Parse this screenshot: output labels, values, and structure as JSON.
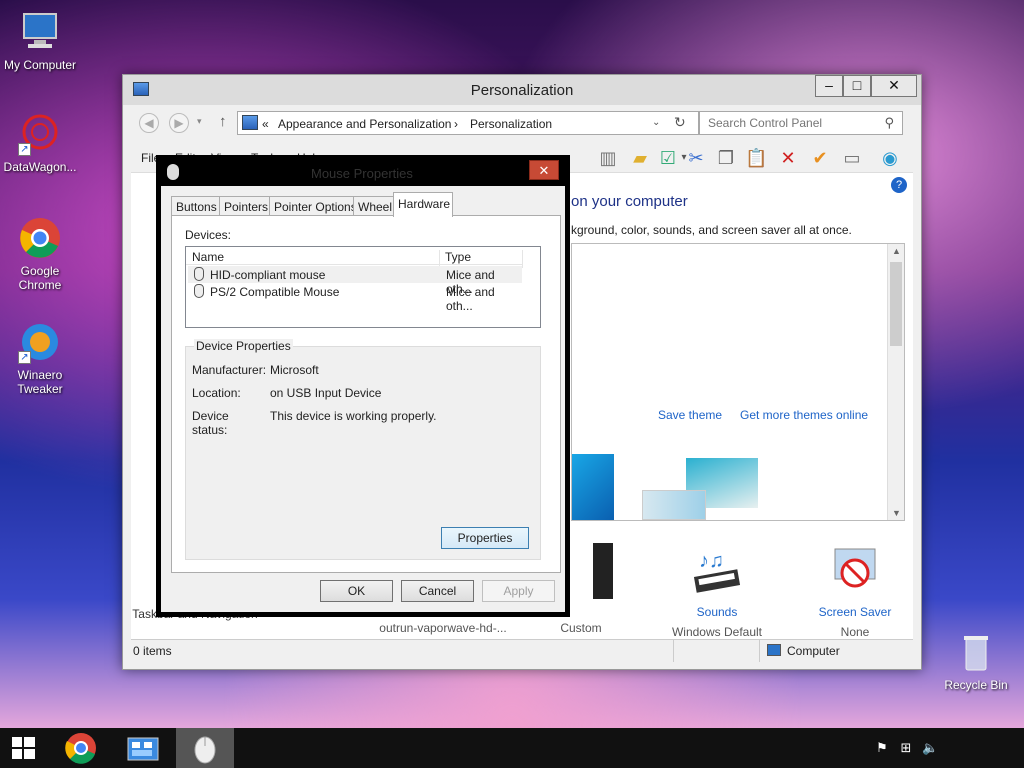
{
  "desktop": {
    "icons": [
      {
        "label": "My Computer"
      },
      {
        "label": "DataWagon..."
      },
      {
        "label": "Google Chrome"
      },
      {
        "label": "Winaero Tweaker"
      },
      {
        "label": "Recycle Bin"
      }
    ]
  },
  "personalization": {
    "title": "Personalization",
    "address": {
      "prefix": "«",
      "crumb1": "Appearance and Personalization",
      "sep": "›",
      "crumb2": "Personalization"
    },
    "search_placeholder": "Search Control Panel",
    "menu": [
      "File",
      "Edit",
      "View",
      "Tools",
      "Help"
    ],
    "heading": "on your computer",
    "subheading": "kground, color, sounds, and screen saver all at once.",
    "save_theme": "Save theme",
    "get_more_themes": "Get more themes online",
    "bottom_items": [
      {
        "label": "Taskbar and Navigation",
        "sub": ""
      },
      {
        "label": "",
        "sub": "outrun-vaporwave-hd-..."
      },
      {
        "label": "",
        "sub": "Custom"
      },
      {
        "label": "Sounds",
        "sub": "Windows Default"
      },
      {
        "label": "Screen Saver",
        "sub": "None"
      }
    ],
    "status": {
      "items": "0 items",
      "computer": "Computer"
    }
  },
  "mouse_dialog": {
    "title": "Mouse Properties",
    "close_glyph": "✕",
    "tabs": [
      "Buttons",
      "Pointers",
      "Pointer Options",
      "Wheel",
      "Hardware"
    ],
    "active_tab": "Hardware",
    "devices_label": "Devices:",
    "columns": {
      "name": "Name",
      "type": "Type"
    },
    "devices": [
      {
        "name": "HID-compliant mouse",
        "type": "Mice and oth..."
      },
      {
        "name": "PS/2 Compatible Mouse",
        "type": "Mice and oth..."
      }
    ],
    "device_properties": {
      "legend": "Device Properties",
      "manufacturer_label": "Manufacturer:",
      "manufacturer": "Microsoft",
      "location_label": "Location:",
      "location": "on USB Input Device",
      "status_label": "Device status:",
      "status": "This device is working properly."
    },
    "properties_button": "Properties",
    "ok": "OK",
    "cancel": "Cancel",
    "apply": "Apply"
  },
  "taskbar": {
    "clock_time": "",
    "colors": {
      "bg": "#111111",
      "active": "#555555"
    }
  }
}
